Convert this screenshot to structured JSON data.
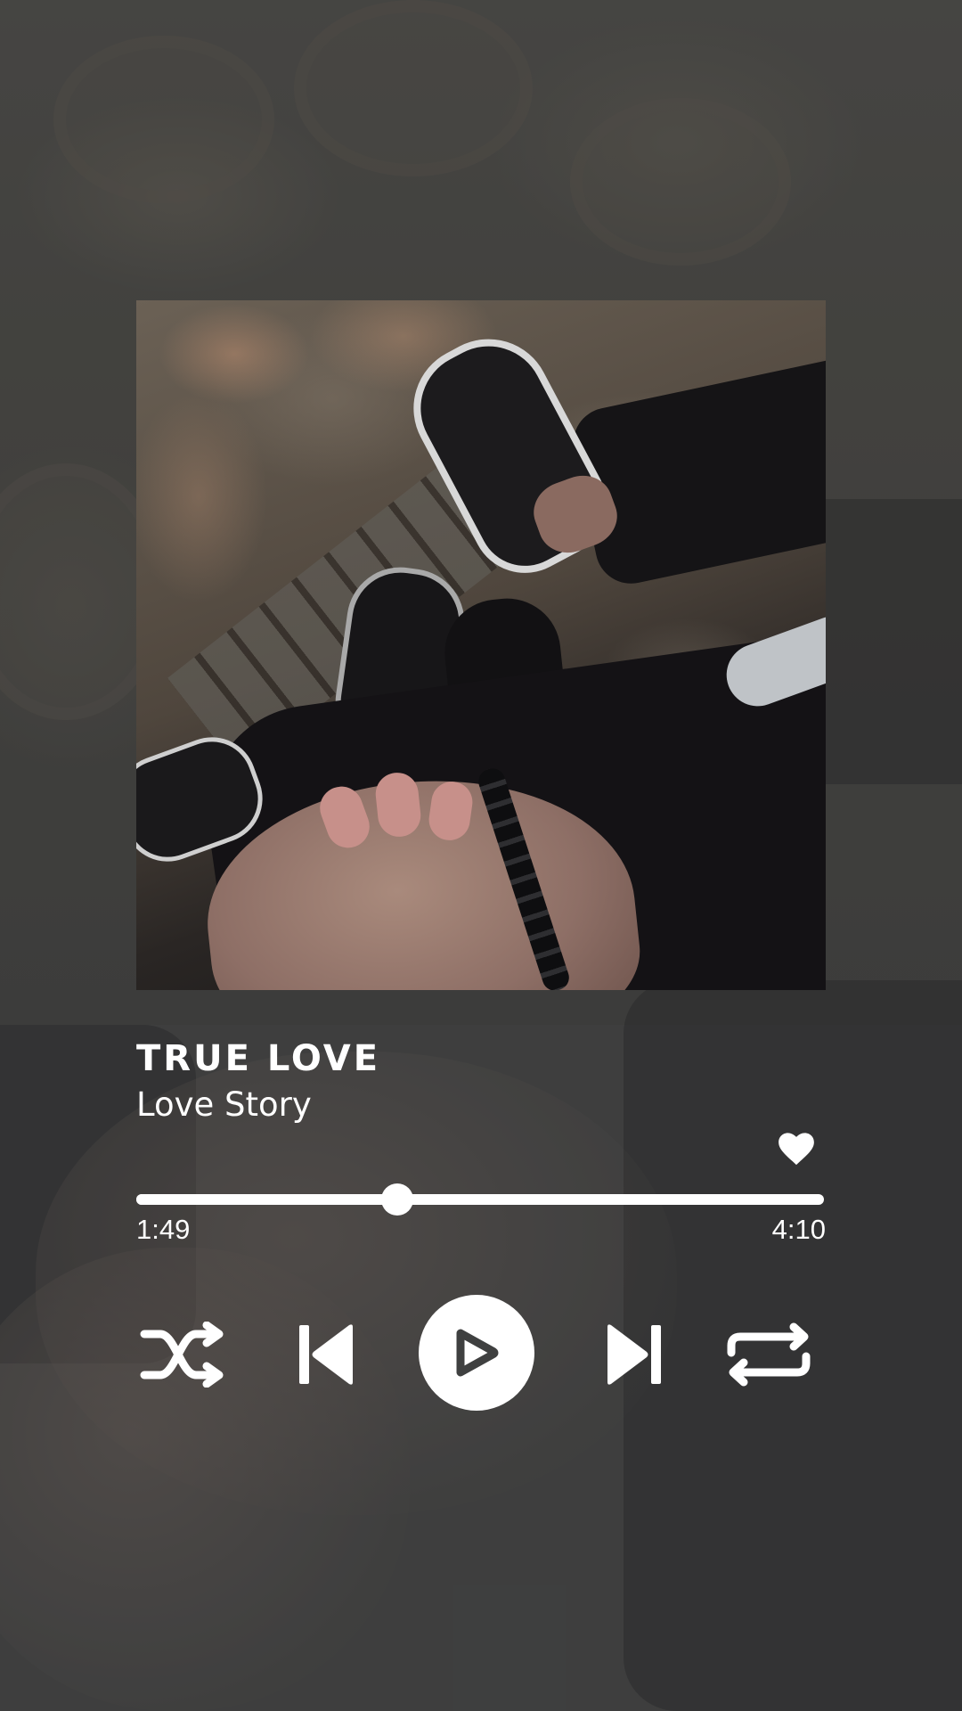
{
  "track": {
    "title": "TRUE LOVE",
    "artist": "Love Story"
  },
  "playback": {
    "current_time": "1:49",
    "total_time": "4:10",
    "progress": 0.38
  },
  "icons": {
    "like": "heart-icon",
    "shuffle": "shuffle-icon",
    "previous": "skip-previous-icon",
    "play": "play-icon",
    "next": "skip-next-icon",
    "repeat": "repeat-icon"
  },
  "colors": {
    "background": "#3f4040",
    "foreground": "#ffffff"
  }
}
